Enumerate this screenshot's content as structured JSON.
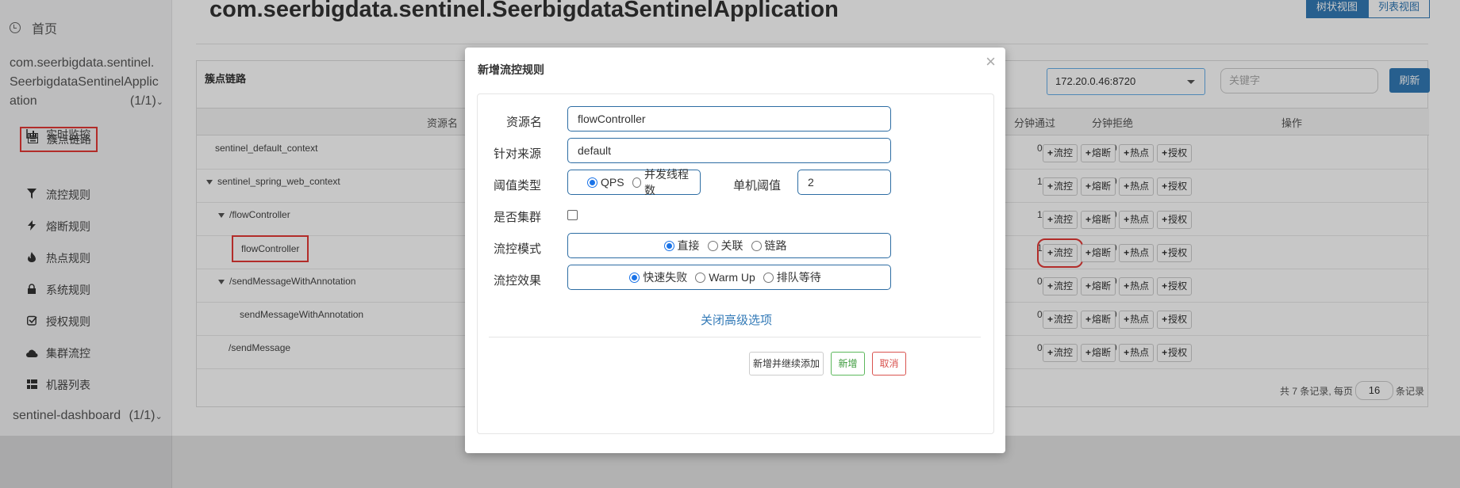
{
  "sidebar": {
    "home": "首页",
    "app": {
      "line1": "com.seerbigdata.sentinel.",
      "line2": "SeerbigdataSentinelApplic",
      "line3": "ation",
      "count": "(1/1)"
    },
    "items": [
      {
        "label": "实时监控",
        "icon": "bar-chart-icon"
      },
      {
        "label": "簇点链路",
        "icon": "list-icon"
      },
      {
        "label": "流控规则",
        "icon": "filter-icon"
      },
      {
        "label": "熔断规则",
        "icon": "flash-icon"
      },
      {
        "label": "热点规则",
        "icon": "fire-icon"
      },
      {
        "label": "系统规则",
        "icon": "lock-icon"
      },
      {
        "label": "授权规则",
        "icon": "check-icon"
      },
      {
        "label": "集群流控",
        "icon": "cloud-icon"
      },
      {
        "label": "机器列表",
        "icon": "grid-icon"
      }
    ],
    "bottom": "sentinel-dashboard",
    "bottom_count": "(1/1)"
  },
  "main": {
    "title": "com.seerbigdata.sentinel.SeerbigdataSentinelApplication",
    "view_tree": "树状视图",
    "view_list": "列表视图",
    "panel_title": "簇点链路",
    "machine": "172.20.0.46:8720",
    "keyword_placeholder": "关键字",
    "refresh": "刷新",
    "headers": {
      "resource": "资源名",
      "pass": "分钟通过",
      "block": "分钟拒绝",
      "ops": "操作"
    },
    "rows": [
      {
        "name": "sentinel_default_context",
        "pass": "0",
        "block": "0"
      },
      {
        "name": "sentinel_spring_web_context",
        "pass": "1",
        "block": "0"
      },
      {
        "name": "/flowController",
        "pass": "1",
        "block": "0"
      },
      {
        "name": "flowController",
        "pass": "1",
        "block": "0"
      },
      {
        "name": "/sendMessageWithAnnotation",
        "pass": "0",
        "block": "0"
      },
      {
        "name": "sendMessageWithAnnotation",
        "pass": "0",
        "block": "0"
      },
      {
        "name": "/sendMessage",
        "pass": "0",
        "block": "0"
      }
    ],
    "ops": {
      "flow": "流控",
      "degrade": "熔断",
      "hot": "热点",
      "auth": "授权"
    },
    "pager": {
      "prefix": "共 7 条记录, 每页",
      "size": "16",
      "suffix": "条记录"
    }
  },
  "modal": {
    "title": "新增流控规则",
    "close": "×",
    "resource_label": "资源名",
    "resource_value": "flowController",
    "limit_app_label": "针对来源",
    "limit_app_value": "default",
    "grade_label": "阈值类型",
    "grade_qps": "QPS",
    "grade_thread": "并发线程数",
    "count_label": "单机阈值",
    "count_value": "2",
    "cluster_label": "是否集群",
    "strategy_label": "流控模式",
    "strategy_direct": "直接",
    "strategy_relate": "关联",
    "strategy_chain": "链路",
    "effect_label": "流控效果",
    "effect_fast": "快速失败",
    "effect_warmup": "Warm Up",
    "effect_queue": "排队等待",
    "advanced": "关闭高级选项",
    "btn_save_continue": "新增并继续添加",
    "btn_save": "新增",
    "btn_cancel": "取消"
  }
}
